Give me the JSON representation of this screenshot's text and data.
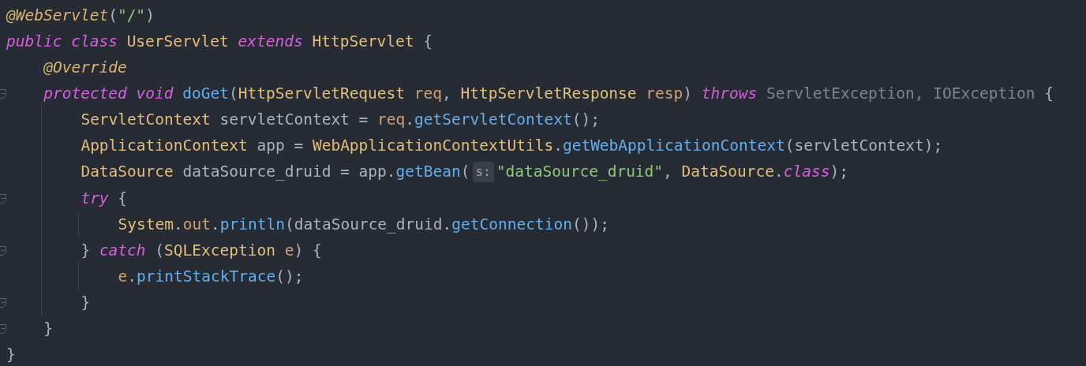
{
  "editor": {
    "lines": [
      {
        "fold": false,
        "tokens": [
          {
            "text": "@WebServlet",
            "kind": "annotation"
          },
          {
            "text": "(",
            "kind": "plain"
          },
          {
            "text": "\"/\"",
            "kind": "string"
          },
          {
            "text": ")",
            "kind": "plain"
          }
        ]
      },
      {
        "fold": false,
        "tokens": [
          {
            "text": "public class ",
            "kind": "keyword"
          },
          {
            "text": "UserServlet ",
            "kind": "type"
          },
          {
            "text": "extends ",
            "kind": "keyword"
          },
          {
            "text": "HttpServlet ",
            "kind": "type"
          },
          {
            "text": "{",
            "kind": "plain"
          }
        ],
        "children": [
          {
            "fold": false,
            "tokens": [
              {
                "text": "@Override",
                "kind": "annotation"
              }
            ]
          },
          {
            "fold": true,
            "tokens": [
              {
                "text": "protected void ",
                "kind": "keyword"
              },
              {
                "text": "doGet",
                "kind": "method"
              },
              {
                "text": "(",
                "kind": "plain"
              },
              {
                "text": "HttpServletRequest ",
                "kind": "type"
              },
              {
                "text": "req",
                "kind": "param"
              },
              {
                "text": ", ",
                "kind": "plain"
              },
              {
                "text": "HttpServletResponse ",
                "kind": "type"
              },
              {
                "text": "resp",
                "kind": "param"
              },
              {
                "text": ") ",
                "kind": "plain"
              },
              {
                "text": "throws ",
                "kind": "keyword"
              },
              {
                "text": "ServletException, IOException ",
                "kind": "unused"
              },
              {
                "text": "{",
                "kind": "plain"
              }
            ],
            "children": [
              {
                "fold": false,
                "tokens": [
                  {
                    "text": "ServletContext ",
                    "kind": "type"
                  },
                  {
                    "text": "servletContext = ",
                    "kind": "plain"
                  },
                  {
                    "text": "req",
                    "kind": "param"
                  },
                  {
                    "text": ".",
                    "kind": "plain"
                  },
                  {
                    "text": "getServletContext",
                    "kind": "method"
                  },
                  {
                    "text": "();",
                    "kind": "plain"
                  }
                ]
              },
              {
                "fold": false,
                "tokens": [
                  {
                    "text": "ApplicationContext ",
                    "kind": "type"
                  },
                  {
                    "text": "app = ",
                    "kind": "plain"
                  },
                  {
                    "text": "WebApplicationContextUtils",
                    "kind": "type"
                  },
                  {
                    "text": ".",
                    "kind": "plain"
                  },
                  {
                    "text": "getWebApplicationContext",
                    "kind": "method"
                  },
                  {
                    "text": "(servletContext);",
                    "kind": "plain"
                  }
                ]
              },
              {
                "fold": false,
                "tokens": [
                  {
                    "text": "DataSource ",
                    "kind": "type"
                  },
                  {
                    "text": "dataSource_druid = app.",
                    "kind": "plain"
                  },
                  {
                    "text": "getBean",
                    "kind": "method"
                  },
                  {
                    "text": "(",
                    "kind": "plain"
                  },
                  {
                    "text": "s:",
                    "kind": "hint"
                  },
                  {
                    "text": "\"dataSource_druid\"",
                    "kind": "string"
                  },
                  {
                    "text": ", ",
                    "kind": "plain"
                  },
                  {
                    "text": "DataSource",
                    "kind": "type"
                  },
                  {
                    "text": ".",
                    "kind": "plain"
                  },
                  {
                    "text": "class",
                    "kind": "keyword"
                  },
                  {
                    "text": ");",
                    "kind": "plain"
                  }
                ]
              },
              {
                "fold": true,
                "tokens": [
                  {
                    "text": "try ",
                    "kind": "keyword"
                  },
                  {
                    "text": "{",
                    "kind": "plain"
                  }
                ],
                "children": [
                  {
                    "fold": false,
                    "tokens": [
                      {
                        "text": "System",
                        "kind": "type"
                      },
                      {
                        "text": ".",
                        "kind": "plain"
                      },
                      {
                        "text": "out",
                        "kind": "param"
                      },
                      {
                        "text": ".",
                        "kind": "plain"
                      },
                      {
                        "text": "println",
                        "kind": "method"
                      },
                      {
                        "text": "(dataSource_druid.",
                        "kind": "plain"
                      },
                      {
                        "text": "getConnection",
                        "kind": "method"
                      },
                      {
                        "text": "());",
                        "kind": "plain"
                      }
                    ]
                  }
                ]
              },
              {
                "fold": true,
                "tokens": [
                  {
                    "text": "} ",
                    "kind": "plain"
                  },
                  {
                    "text": "catch ",
                    "kind": "keyword"
                  },
                  {
                    "text": "(",
                    "kind": "plain"
                  },
                  {
                    "text": "SQLException ",
                    "kind": "type"
                  },
                  {
                    "text": "e",
                    "kind": "param"
                  },
                  {
                    "text": ") {",
                    "kind": "plain"
                  }
                ],
                "children": [
                  {
                    "fold": false,
                    "tokens": [
                      {
                        "text": "e",
                        "kind": "param"
                      },
                      {
                        "text": ".",
                        "kind": "plain"
                      },
                      {
                        "text": "printStackTrace",
                        "kind": "method"
                      },
                      {
                        "text": "();",
                        "kind": "plain"
                      }
                    ]
                  }
                ]
              },
              {
                "fold": true,
                "tokens": [
                  {
                    "text": "}",
                    "kind": "plain"
                  }
                ]
              }
            ]
          },
          {
            "fold": true,
            "tokens": [
              {
                "text": "}",
                "kind": "plain"
              }
            ]
          }
        ]
      },
      {
        "fold": false,
        "tokens": [
          {
            "text": "}",
            "kind": "plain"
          }
        ]
      }
    ]
  }
}
